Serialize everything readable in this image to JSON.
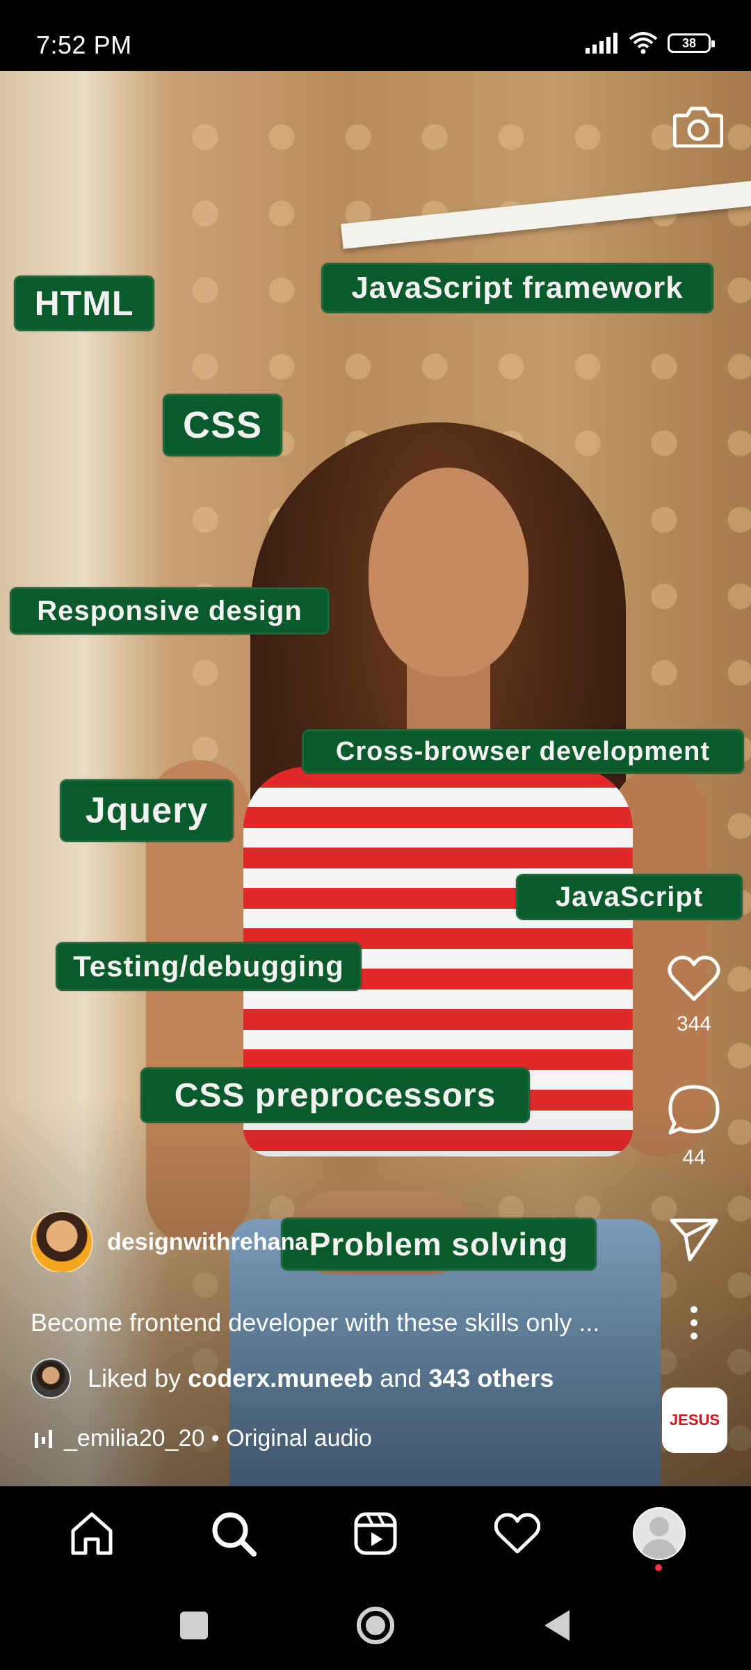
{
  "status_bar": {
    "time": "7:52 PM",
    "battery": "38"
  },
  "video": {
    "skill_tags": [
      "HTML",
      "JavaScript framework",
      "CSS",
      "Responsive design",
      "Cross-browser development",
      "Jquery",
      "JavaScript",
      "Testing/debugging",
      "CSS preprocessors",
      "Problem solving"
    ]
  },
  "actions": {
    "likes": "344",
    "comments": "44"
  },
  "post": {
    "username": "designwithrehana",
    "caption": "Become frontend developer with these skills only ...",
    "liked_prefix": "Liked by",
    "liked_user": "coderx.muneeb",
    "liked_and": "and",
    "liked_others": "343 others",
    "audio_user": "_emilia20_20",
    "audio_sep": "•",
    "audio_label": "Original audio",
    "sticker_text": "JESUS"
  },
  "bottom_nav": [
    "home",
    "search",
    "reels",
    "activity",
    "profile"
  ]
}
